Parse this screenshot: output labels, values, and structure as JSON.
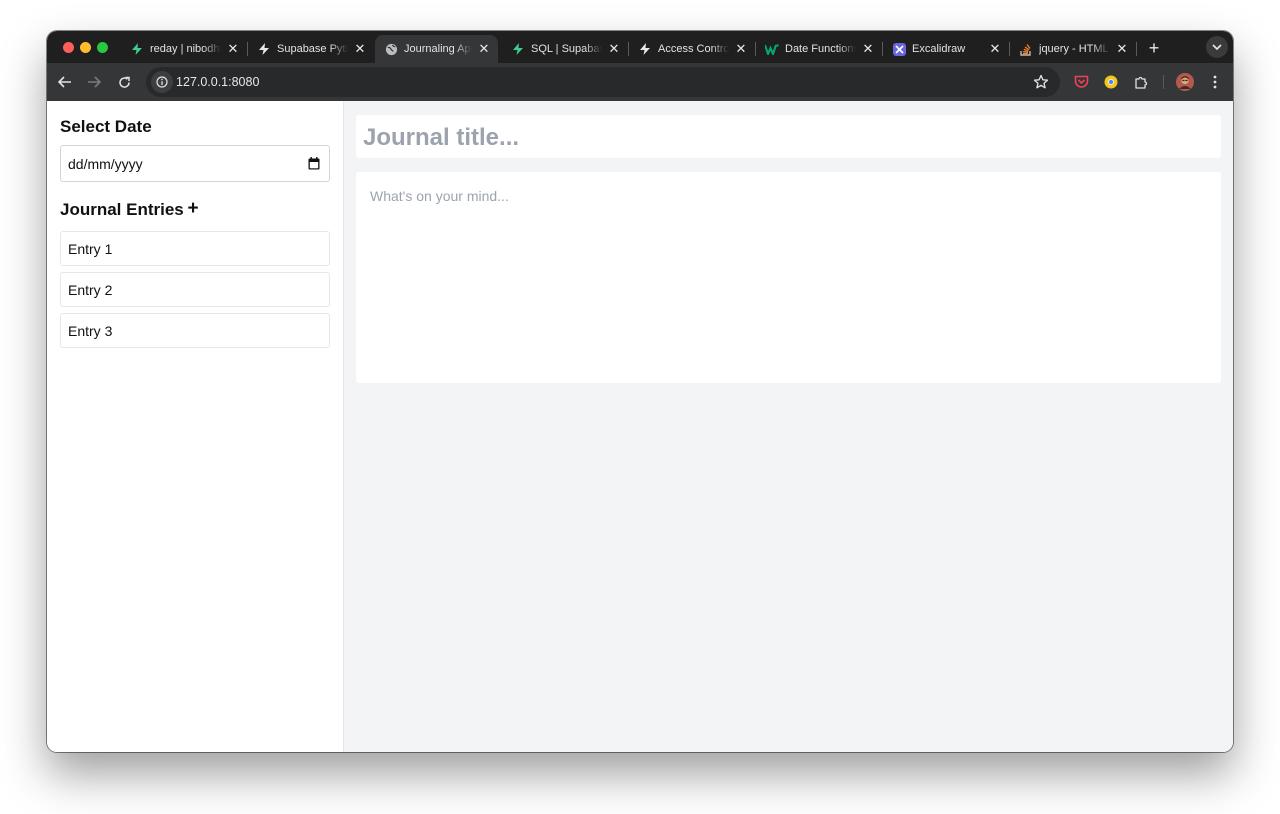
{
  "browser": {
    "tabs": [
      {
        "title": "reday | nibodhdaware",
        "icon": "supabase-icon",
        "active": false
      },
      {
        "title": "Supabase Python",
        "icon": "supabase-icon",
        "active": false
      },
      {
        "title": "Journaling App",
        "icon": "globe-icon",
        "active": true
      },
      {
        "title": "SQL | Supabase",
        "icon": "supabase-icon",
        "active": false
      },
      {
        "title": "Access Control",
        "icon": "supabase-icon",
        "active": false
      },
      {
        "title": "Date Functions",
        "icon": "w3schools-icon",
        "active": false
      },
      {
        "title": "Excalidraw",
        "icon": "excalidraw-icon",
        "active": false
      },
      {
        "title": "jquery - HTML",
        "icon": "stackoverflow-icon",
        "active": false
      }
    ],
    "url": "127.0.0.1:8080"
  },
  "sidebar": {
    "select_date_heading": "Select Date",
    "date_value": "dd/mm/yyyy",
    "entries_heading": "Journal Entries",
    "add_label": "+",
    "entries": [
      {
        "label": "Entry 1"
      },
      {
        "label": "Entry 2"
      },
      {
        "label": "Entry 3"
      }
    ]
  },
  "editor": {
    "title_placeholder": "Journal title...",
    "body_placeholder": "What's on your mind..."
  },
  "colors": {
    "supabase_green": "#3ecf8e",
    "placeholder_gray": "#9ca3af",
    "main_background": "#f3f4f6"
  }
}
